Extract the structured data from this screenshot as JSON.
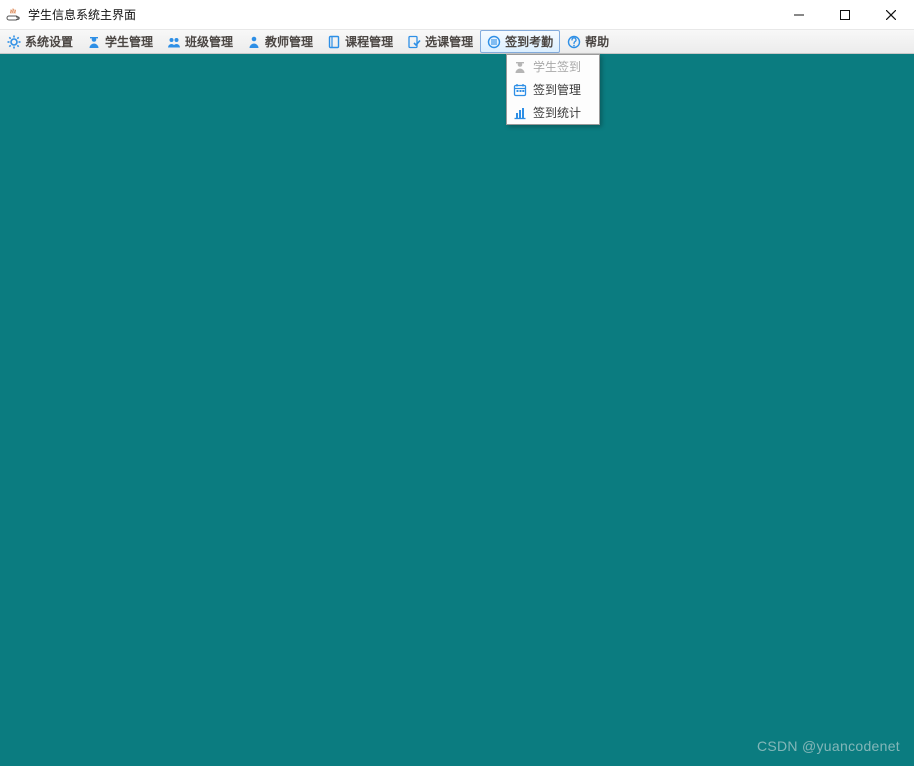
{
  "window": {
    "title": "学生信息系统主界面",
    "minimize_tooltip": "Minimize",
    "maximize_tooltip": "Maximize",
    "close_tooltip": "Close"
  },
  "menubar": {
    "items": [
      {
        "label": "系统设置",
        "icon": "gear-icon"
      },
      {
        "label": "学生管理",
        "icon": "student-icon"
      },
      {
        "label": "班级管理",
        "icon": "class-icon"
      },
      {
        "label": "教师管理",
        "icon": "teacher-icon"
      },
      {
        "label": "课程管理",
        "icon": "course-icon"
      },
      {
        "label": "选课管理",
        "icon": "select-course-icon"
      },
      {
        "label": "签到考勤",
        "icon": "attendance-icon",
        "open": true
      },
      {
        "label": "帮助",
        "icon": "help-icon"
      }
    ]
  },
  "attendance_dropdown": {
    "items": [
      {
        "label": "学生签到",
        "icon": "student-icon",
        "disabled": true
      },
      {
        "label": "签到管理",
        "icon": "calendar-icon",
        "disabled": false
      },
      {
        "label": "签到统计",
        "icon": "barchart-icon",
        "disabled": false
      }
    ]
  },
  "watermark": "CSDN @yuancodenet",
  "icon_colors": {
    "primary": "#2e8fe6",
    "disabled": "#b5b5b5"
  }
}
